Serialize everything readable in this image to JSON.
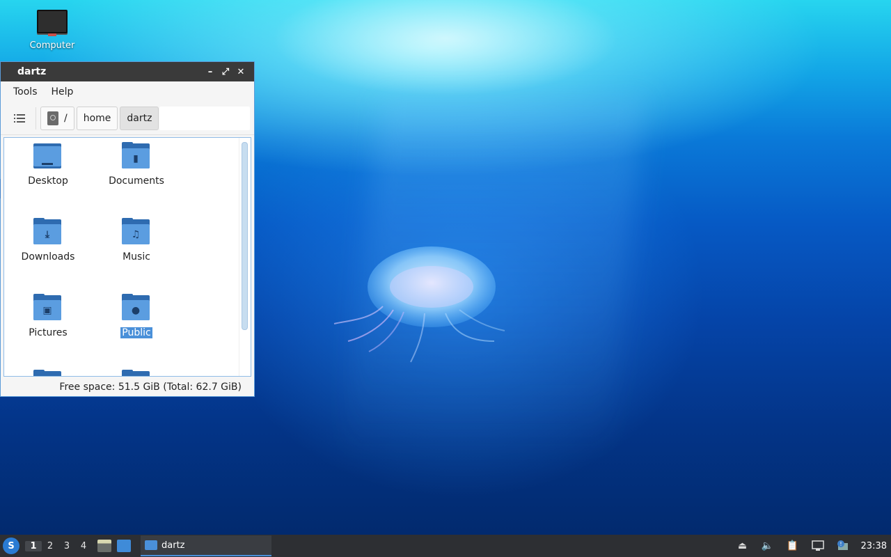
{
  "desktop": {
    "icons": [
      {
        "label": "Computer",
        "icon": "monitor-icon"
      }
    ]
  },
  "window": {
    "title": "dartz",
    "controls": {
      "minimize": "–",
      "maximize": "⤢",
      "close": "✕"
    },
    "menu": [
      "Tools",
      "Help"
    ],
    "toolbar": {
      "view_list_icon": "list-view-icon"
    },
    "breadcrumb": [
      {
        "label": "/",
        "icon": "drive-icon"
      },
      {
        "label": "home"
      },
      {
        "label": "dartz",
        "active": true
      }
    ],
    "items": [
      {
        "name": "Desktop",
        "icon": "desktop-folder-icon",
        "glyph": ""
      },
      {
        "name": "Documents",
        "icon": "documents-folder-icon",
        "glyph": "▮"
      },
      {
        "name": "Downloads",
        "icon": "downloads-folder-icon",
        "glyph": "⤓"
      },
      {
        "name": "Music",
        "icon": "music-folder-icon",
        "glyph": "♫"
      },
      {
        "name": "Pictures",
        "icon": "pictures-folder-icon",
        "glyph": "▣"
      },
      {
        "name": "Public",
        "icon": "public-folder-icon",
        "glyph": "●",
        "selected": true
      }
    ],
    "status": "Free space: 51.5 GiB (Total: 62.7 GiB)"
  },
  "taskbar": {
    "start_icon": "lubuntu-logo-icon",
    "workspaces": [
      "1",
      "2",
      "3",
      "4"
    ],
    "active_workspace": "1",
    "task_label": "dartz",
    "tray_icons": [
      "eject-icon",
      "volume-icon",
      "clipboard-icon",
      "network-icon",
      "update-notifier-icon"
    ],
    "clock": "23:38"
  }
}
